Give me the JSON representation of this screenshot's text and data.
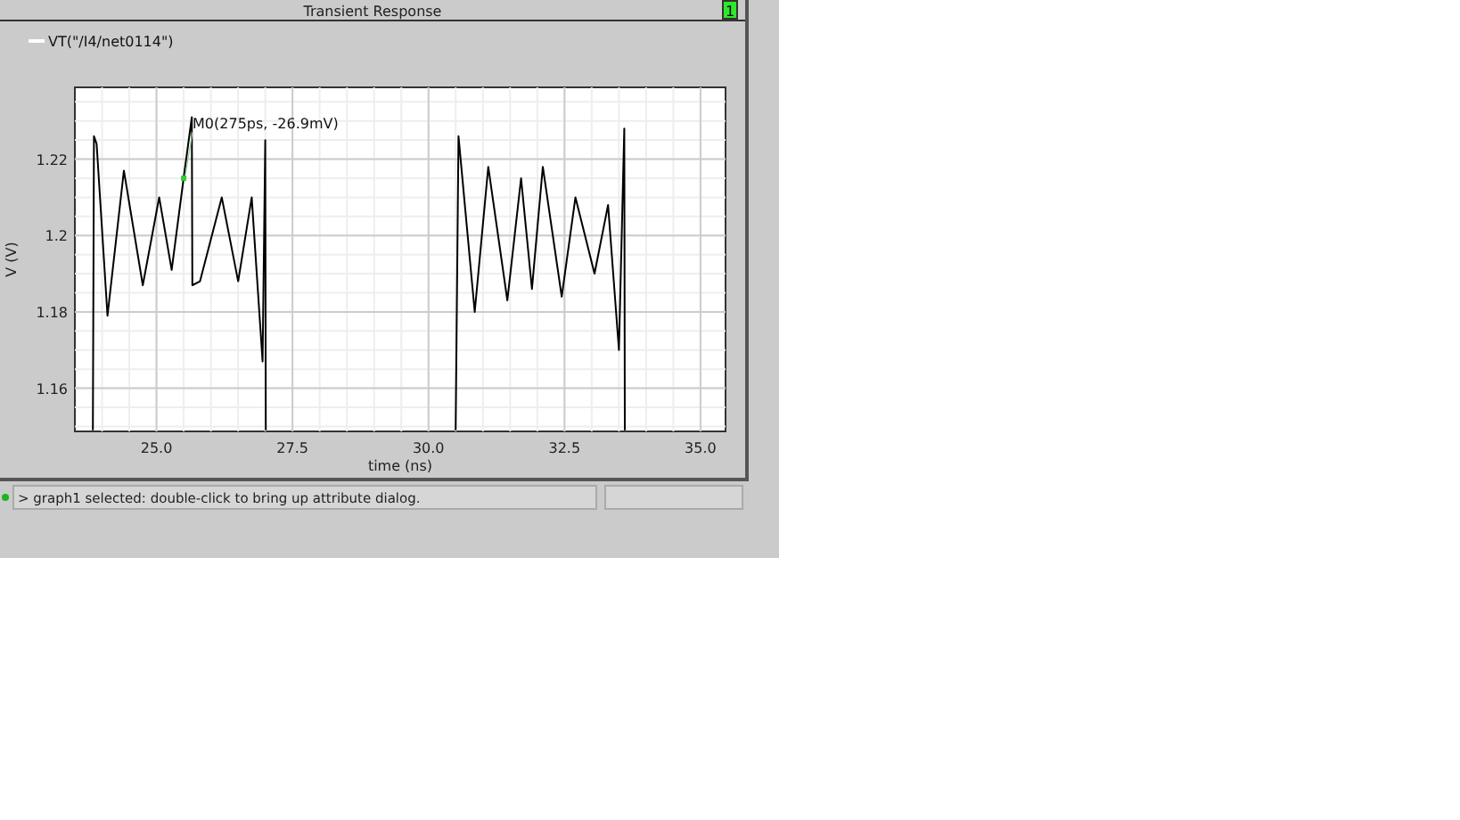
{
  "window": {
    "title": "Transient Response",
    "badge": "1"
  },
  "chart_data": {
    "type": "line",
    "grid": true,
    "xlabel": "time (ns)",
    "ylabel": "V (V)",
    "xlim": [
      23.5,
      35.46
    ],
    "ylim": [
      1.1487,
      1.2388
    ],
    "xticks": [
      {
        "value": 25,
        "label": "25.0"
      },
      {
        "value": 27.5,
        "label": "27.5"
      },
      {
        "value": 30,
        "label": "30.0"
      },
      {
        "value": 32.5,
        "label": "32.5"
      },
      {
        "value": 35,
        "label": "35.0"
      }
    ],
    "yticks": [
      1.16,
      1.18,
      1.2,
      1.22
    ],
    "x": [
      23.83,
      23.85,
      23.9,
      24.1,
      24.4,
      24.75,
      25.05,
      25.28,
      25.5,
      25.65,
      25.66,
      25.8,
      26.2,
      26.5,
      26.75,
      26.95,
      27.0,
      27.01,
      28.5,
      30.5,
      30.55,
      30.85,
      31.1,
      31.45,
      31.7,
      31.9,
      32.1,
      32.45,
      32.7,
      33.05,
      33.3,
      33.5,
      33.6,
      33.61
    ],
    "series": [
      {
        "name": "VT(\"/I4/net0114\")",
        "color": "#000000",
        "values": [
          1.149,
          1.226,
          1.224,
          1.179,
          1.217,
          1.187,
          1.21,
          1.191,
          1.215,
          1.231,
          1.187,
          1.188,
          1.21,
          1.188,
          1.21,
          1.167,
          1.225,
          1.149,
          null,
          1.149,
          1.226,
          1.18,
          1.218,
          1.183,
          1.215,
          1.186,
          1.218,
          1.184,
          1.21,
          1.19,
          1.208,
          1.17,
          1.228,
          1.149
        ]
      }
    ],
    "annotations": [
      {
        "text": "M0(275ps, -26.9mV)",
        "x": 25.5,
        "y": 1.215
      }
    ]
  },
  "status_bar": {
    "message": "> graph1 selected: double-click to bring up attribute dialog."
  }
}
